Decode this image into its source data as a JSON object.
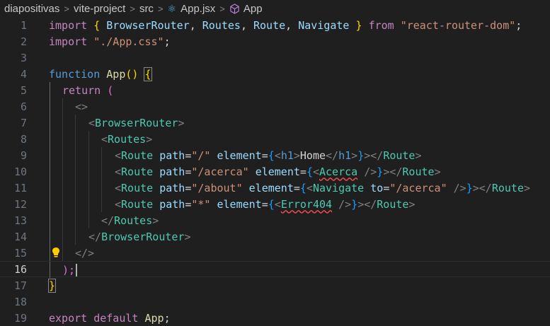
{
  "breadcrumb": {
    "items": [
      "diapositivas",
      "vite-project",
      "src",
      "App.jsx",
      "App"
    ],
    "separator": ">"
  },
  "editor": {
    "active_line": "16",
    "lines": [
      {
        "n": "1"
      },
      {
        "n": "2"
      },
      {
        "n": "3"
      },
      {
        "n": "4"
      },
      {
        "n": "5"
      },
      {
        "n": "6"
      },
      {
        "n": "7"
      },
      {
        "n": "8"
      },
      {
        "n": "9"
      },
      {
        "n": "10"
      },
      {
        "n": "11"
      },
      {
        "n": "12"
      },
      {
        "n": "13"
      },
      {
        "n": "14"
      },
      {
        "n": "15"
      },
      {
        "n": "16"
      },
      {
        "n": "17"
      },
      {
        "n": "18"
      },
      {
        "n": "19"
      }
    ],
    "tokens": {
      "import": "import",
      "open_brace": "{",
      "close_brace": "}",
      "BrowserRouter": "BrowserRouter",
      "Routes": "Routes",
      "Route": "Route",
      "Navigate": "Navigate",
      "comma": ",",
      "from": "from",
      "pkg": "\"react-router-dom\"",
      "css": "\"./App.css\"",
      "semi": ";",
      "function": "function",
      "App": "App",
      "parens": "()",
      "return": "return",
      "open_paren": "(",
      "frag_open": "<>",
      "frag_close": "</>",
      "lt": "<",
      "lt_slash": "</",
      "gt": ">",
      "self_close": "/>",
      "path_attr": "path",
      "element_attr": "element",
      "to_attr": "to",
      "eq": "=",
      "p_root": "\"/\"",
      "p_acerca": "\"/acerca\"",
      "p_about": "\"/about\"",
      "p_star": "\"*\"",
      "h1": "h1",
      "home": "Home",
      "Acerca": "Acerca",
      "Error404": "Error404",
      "close_paren_semi": ");",
      "export": "export",
      "default": "default"
    }
  },
  "colors": {
    "background": "#1f1f1f",
    "keyword": "#c586c0",
    "function": "#dcdcaa",
    "string": "#ce9178",
    "component": "#4ec9b0",
    "error_squiggle": "#f14c4c"
  },
  "icons": {
    "react_file": "react-icon",
    "symbol": "cube-icon",
    "lightbulb": "lightbulb-icon"
  }
}
